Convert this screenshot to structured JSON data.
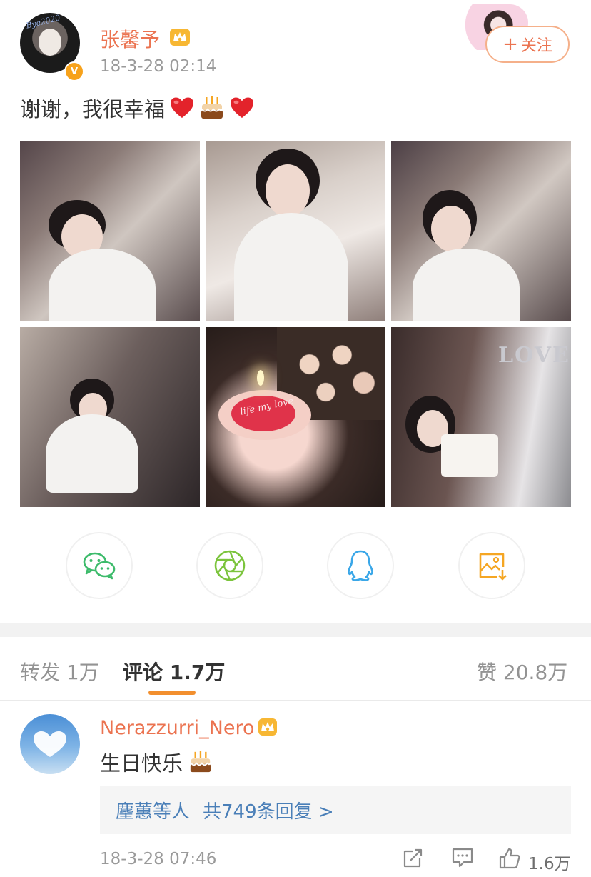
{
  "post": {
    "username": "张馨予",
    "timestamp": "18-3-28 02:14",
    "follow_label": "关注",
    "follow_plus": "+",
    "text": "谢谢，我很幸福",
    "avatar_tag": "Bye2020",
    "verified_mark": "V",
    "emojis": [
      "heart-icon",
      "cake-icon",
      "heart-icon"
    ],
    "photos": [
      "photo-1",
      "photo-2",
      "photo-3",
      "photo-4",
      "photo-5",
      "photo-6"
    ],
    "cake_writing": "life my love",
    "love_sign": "LOVE"
  },
  "share": [
    "wechat-icon",
    "moments-icon",
    "qq-icon",
    "save-image-icon"
  ],
  "tabs": {
    "repost_label": "转发",
    "repost_count": "1万",
    "comment_label": "评论",
    "comment_count": "1.7万",
    "like_label": "赞",
    "like_count": "20.8万"
  },
  "comment": {
    "author": "Nerazzurri_Nero",
    "text": "生日快乐",
    "replies_prefix": "麈蕙等人",
    "replies_label": "共749条回复 >",
    "timestamp": "18-3-28 07:46",
    "likes": "1.6万"
  },
  "colors": {
    "accent": "#eb7350",
    "link": "#4a7fb8",
    "tab_underline": "#f28f2e"
  }
}
